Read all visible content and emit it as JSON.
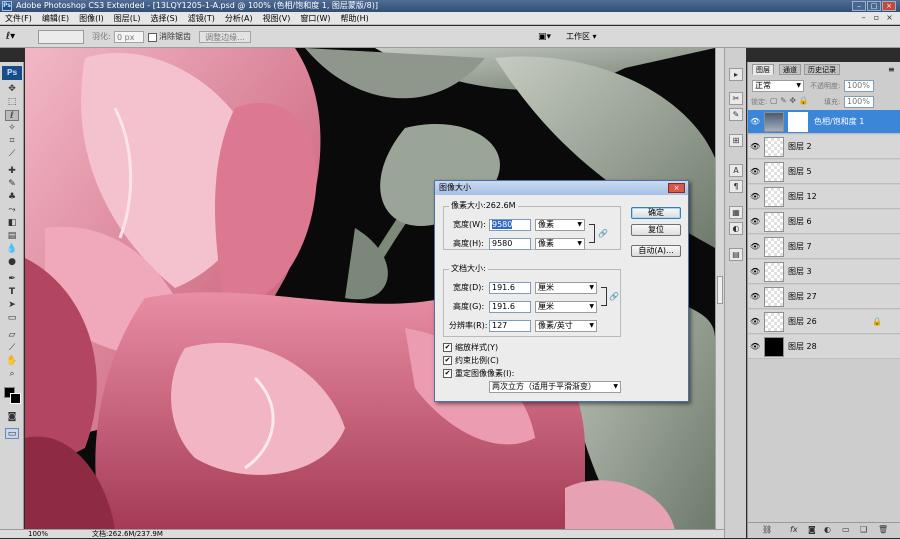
{
  "title_bar": {
    "logo": "Ps",
    "title": "Adobe Photoshop CS3 Extended - [13LQY1205-1-A.psd @ 100% (色相/饱和度 1, 图层蒙版/8)]"
  },
  "menu": [
    "文件(F)",
    "编辑(E)",
    "图像(I)",
    "图层(L)",
    "选择(S)",
    "滤镜(T)",
    "分析(A)",
    "视图(V)",
    "窗口(W)",
    "帮助(H)"
  ],
  "options_bar": {
    "feather_label": "羽化:",
    "feather_value": "0 px",
    "antialias_label": "消除锯齿",
    "refine_edge": "调整边缘...",
    "workspace": "工作区"
  },
  "toolbox": {
    "logo": "Ps"
  },
  "status": {
    "zoom": "100%",
    "doc": "文档:262.6M/237.9M"
  },
  "layers_panel": {
    "tabs": [
      "图层",
      "通道",
      "历史记录"
    ],
    "blend_mode": "正常",
    "opacity_label": "不透明度:",
    "opacity": "100%",
    "lock_label": "锁定:",
    "fill_label": "填充:",
    "fill": "100%",
    "layers": [
      {
        "name": "色相/饱和度 1",
        "selected": true
      },
      {
        "name": "图层 2"
      },
      {
        "name": "图层 5"
      },
      {
        "name": "图层 12"
      },
      {
        "name": "图层 6"
      },
      {
        "name": "图层 7"
      },
      {
        "name": "图层 3"
      },
      {
        "name": "图层 27"
      },
      {
        "name": "图层 26"
      },
      {
        "name": "图层 28"
      }
    ]
  },
  "dialog": {
    "title": "图像大小",
    "pixel_dims_label": "像素大小:262.6M",
    "width_label": "宽度(W):",
    "width_value": "9580",
    "width_unit": "像素",
    "height_label": "高度(H):",
    "height_value": "9580",
    "height_unit": "像素",
    "doc_size_label": "文档大小:",
    "doc_width_label": "宽度(D):",
    "doc_width_value": "191.6",
    "doc_width_unit": "厘米",
    "doc_height_label": "高度(G):",
    "doc_height_value": "191.6",
    "doc_height_unit": "厘米",
    "resolution_label": "分辨率(R):",
    "resolution_value": "127",
    "resolution_unit": "像素/英寸",
    "scale_styles": "缩放样式(Y)",
    "constrain": "约束比例(C)",
    "resample": "重定图像像素(I):",
    "resample_method": "两次立方（适用于平滑渐变）",
    "ok": "确定",
    "reset": "复位",
    "auto": "自动(A)..."
  }
}
